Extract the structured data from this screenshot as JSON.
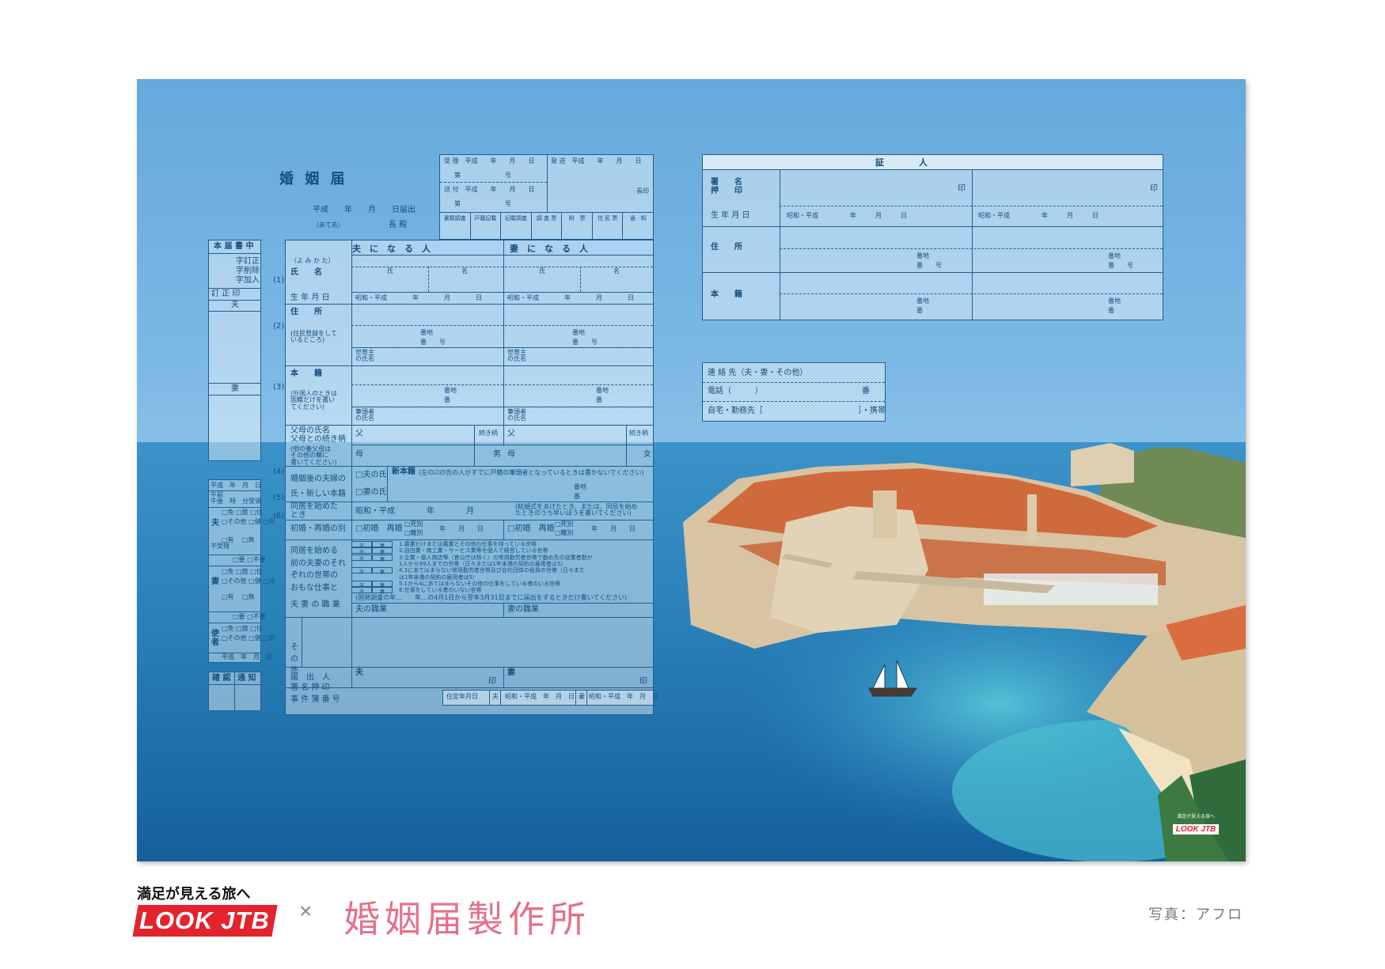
{
  "form": {
    "title": "婚 姻 届",
    "date_line": "平成　　年　　月　　日届出",
    "to_small": "（あて先）",
    "to": "長 殿",
    "left_panel": {
      "head": "本 届 書 中",
      "l1": "字訂正",
      "l2": "字削除",
      "l3": "字加入",
      "correction_seal": "訂 正 印",
      "husband": "夫",
      "wife": "妻"
    },
    "reception": {
      "received": "受 理　平成　　年　　月　　日",
      "no1": "第　　　　　　　号",
      "sent": "送 付　平成　　年　　月　　日",
      "no2": "第　　　　　　　号",
      "dispatch": "発 送　平成　　年　　月　　日",
      "chief": "長印",
      "cols": [
        "書類調査",
        "戸籍記載",
        "記載調査",
        "調 査 票",
        "附　票",
        "住 民 票",
        "通　知"
      ]
    },
    "columns": {
      "husband": "夫　に　な　る　人",
      "wife": "妻　に　な　る　人"
    },
    "rows": {
      "yomikata": "（よ み か た）",
      "name": "氏　　名",
      "shi": "氏",
      "mei": "名",
      "birth": "生 年 月 日",
      "era": "昭和・平成　　　　年　　　　月　　　　日",
      "address": "住　　所",
      "address_note": "(住民登録をして\nいるところ)",
      "banchi": "番地",
      "ban": "番　　号",
      "setainushi": "世帯主\nの氏名",
      "honseki": "本　　籍",
      "honseki_note": "(外国人のときは\n国籍だけを書い\nてください)",
      "ban2": "番",
      "hittousha": "筆頭者\nの氏名",
      "parents": "父母の氏名\n父母との続き柄",
      "parents_note": "(他の養父母は\nその他の欄に\n書いてください)",
      "father": "父",
      "mother": "母",
      "relation": "続き柄",
      "male": "男",
      "female": "女",
      "new_surname": "婚姻後の夫婦の\n氏・新しい本籍",
      "husband_surname": "□夫の氏",
      "wife_surname": "□妻の氏",
      "new_honseki": "新本籍",
      "new_honseki_note": "(左の☑の氏の人がすでに戸籍の筆頭者となっているときは書かないでください)",
      "cohabit": "同居を始めた\nとき",
      "cohabit_date": "昭和・平成　　　　年　　　　月",
      "cohabit_note": "(結婚式をあげたとき、または、同居を始め\nたときのうち早いほうを書いてください)",
      "first_marriage": "初婚・再婚の別",
      "first_h": "□初婚　再婚",
      "first_w": "□初婚　再婚",
      "death": "□死別",
      "divorce": "□離別",
      "ymd": "年　　月　　日",
      "work_label": "同居を始める\n前の夫妻のそれ\nぞれの世帯の\nおもな仕事と",
      "job_label": "夫 妻 の 職 業",
      "work1": "1.農業だけまたは農業とその他の仕事を持っている世帯",
      "work2": "2.自由業・商工業・サービス業等を個人で経営している世帯",
      "work3": "3.企業・個人商店等（官公庁は除く）の常用勤労者世帯で勤め先の従業者数が",
      "work3b": "1人から99人までの世帯（日々または1年未満の契約の雇用者は5）",
      "work4": "4.3にあてはまらない常用勤労者世帯及び会社団体の役員の世帯（日々また",
      "work4b": "は1年未満の契約の雇用者は5）",
      "work5": "5.1から4にあてはまらないその他の仕事をしている者のいる世帯",
      "work6": "6.仕事をしている者のいない世帯",
      "census_note": "(国勢調査の年…　　年…の4月1日から翌年3月31日までに届出をするときだけ書いてください)",
      "husband_job": "夫の職業",
      "wife_job": "妻の職業",
      "sonota": "そ\nの\n他",
      "filer": "届　出　人\n署 名 押 印",
      "h": "夫",
      "w": "妻",
      "seal": "印",
      "case_no": "事 件 簿 番 号",
      "residence_date": "住定年月日",
      "era_short": "昭和・平成　年　月　日"
    },
    "witness": {
      "title": "証　　　　人",
      "sign": "署　　名\n押　　印",
      "seal": "印",
      "birth": "生 年 月 日",
      "era": "昭和・平成　　　　　年　　　月　　　日",
      "address": "住　　所",
      "honseki": "本　　籍",
      "banchi": "番地",
      "gou": "番　　号",
      "ban": "番"
    },
    "contact": {
      "title": "連 絡 先（夫・妻・その他）",
      "phone": "電話（　　　）　　　　　　　　　　　　　番",
      "home": "自宅・勤務先［　　　　　　　　　　　　］・携帯"
    },
    "side_nums": [
      "(1)",
      "(2)",
      "(3)",
      "(4)",
      "(5)",
      "(6)"
    ],
    "lower_left": {
      "date": "平成　年　月　日",
      "time": "午前\n午後　時　分受領",
      "h": "夫",
      "w": "妻",
      "u": "使\n者",
      "opts1": "□免 □旅 □住",
      "opts2": "□その他 □健 □外",
      "yes": "□有",
      "no": "□無",
      "fuyou": "不受理",
      "req": "□要 □不要",
      "kakunin": "確 認",
      "tsuuchi": "通 知"
    }
  },
  "badge": {
    "caption": "満足が見える旅へ",
    "logo": "LOOK JTB"
  },
  "footer": {
    "tagline": "満足が見える旅へ",
    "logo": "LOOK JTB",
    "cross": "×",
    "brand": "婚姻届製作所",
    "credit": "写真：アフロ"
  },
  "colors": {
    "form_line": "#1f5f93",
    "sea": "#2a7fb8",
    "sky": "#66a9dc",
    "brand_red": "#e3232e",
    "pink": "#e5708a"
  }
}
